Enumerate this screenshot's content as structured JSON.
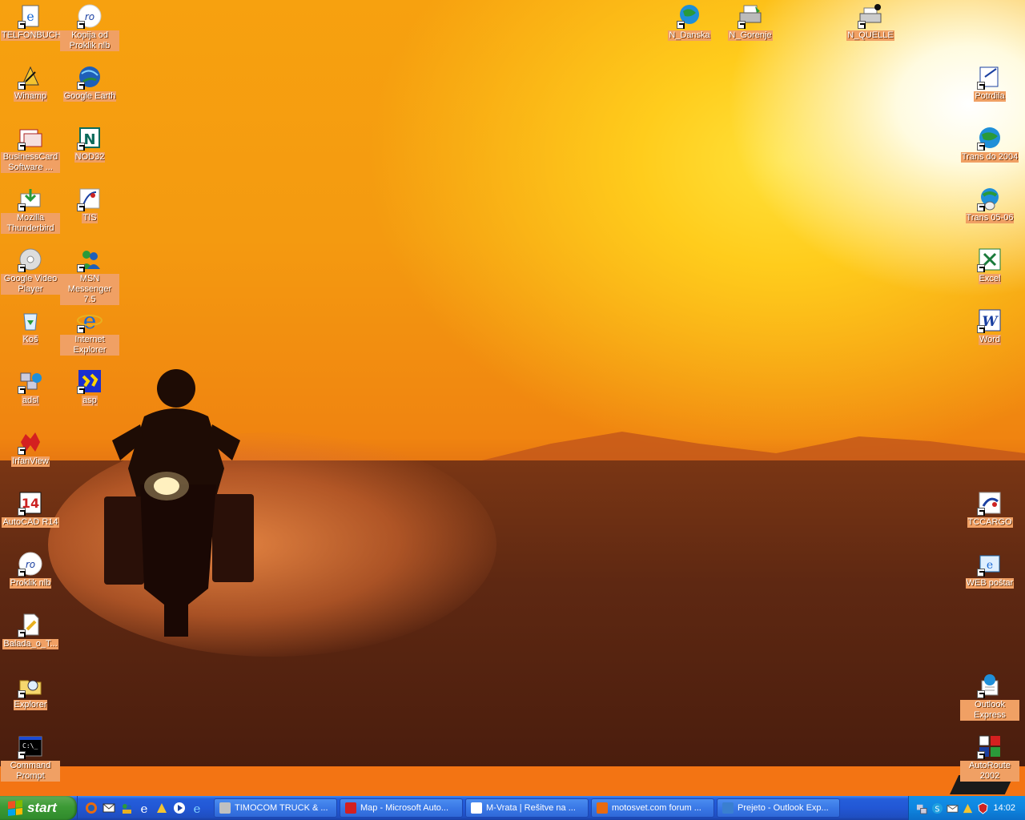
{
  "desktop": {
    "icons": [
      {
        "label": "TELFONBUCH",
        "icon": "internet-explorer-doc-icon"
      },
      {
        "label": "Kopija od Proklik nlb",
        "icon": "proklik-icon"
      },
      {
        "label": "Winamp",
        "icon": "winamp-icon"
      },
      {
        "label": "Google Earth",
        "icon": "google-earth-icon"
      },
      {
        "label": "BusinessCard Software ...",
        "icon": "businesscard-icon"
      },
      {
        "label": "NOD32",
        "icon": "nod32-icon"
      },
      {
        "label": "Mozilla Thunderbird",
        "icon": "thunderbird-icon"
      },
      {
        "label": "TIS",
        "icon": "tis-icon"
      },
      {
        "label": "Google Video Player",
        "icon": "google-video-icon"
      },
      {
        "label": "MSN Messenger 7.5",
        "icon": "msn-messenger-icon"
      },
      {
        "label": "Koš",
        "icon": "recycle-bin-icon"
      },
      {
        "label": "Internet Explorer",
        "icon": "internet-explorer-icon"
      },
      {
        "label": "adsl",
        "icon": "network-icon"
      },
      {
        "label": "asp",
        "icon": "asp-icon"
      },
      {
        "label": "IrfanView",
        "icon": "irfanview-icon"
      },
      {
        "label": "AutoCAD R14",
        "icon": "autocad-icon"
      },
      {
        "label": "Proklik nlb",
        "icon": "proklik-icon"
      },
      {
        "label": "Balada_o_T...",
        "icon": "document-icon"
      },
      {
        "label": "Explorer",
        "icon": "explorer-icon"
      },
      {
        "label": "Command Prompt",
        "icon": "command-prompt-icon"
      },
      {
        "label": "N_Danska",
        "icon": "network-globe-icon"
      },
      {
        "label": "N_Gorenje",
        "icon": "printer-icon"
      },
      {
        "label": "N_QUELLE",
        "icon": "printer-default-icon"
      },
      {
        "label": "Potrdila",
        "icon": "certificate-icon"
      },
      {
        "label": "Trans do 2004",
        "icon": "globe-icon"
      },
      {
        "label": "Trans 05-06",
        "icon": "globe-mouse-icon"
      },
      {
        "label": "Excel",
        "icon": "excel-icon"
      },
      {
        "label": "Word",
        "icon": "word-icon"
      },
      {
        "label": "TCCARGO",
        "icon": "tccargo-icon"
      },
      {
        "label": "WEB poštar",
        "icon": "web-postar-icon"
      },
      {
        "label": "Outlook Express",
        "icon": "outlook-express-icon"
      },
      {
        "label": "AutoRoute 2002",
        "icon": "autoroute-icon"
      }
    ]
  },
  "taskbar": {
    "start_label": "start",
    "quick_launch": [
      "firefox-icon",
      "outlook-icon",
      "msn-icon",
      "ie-icon",
      "winamp-icon",
      "media-player-icon",
      "ie-alt-icon"
    ],
    "tasks": [
      {
        "label": "TIMOCOM TRUCK & ...",
        "color": "#c0c0c0"
      },
      {
        "label": "Map - Microsoft Auto...",
        "color": "#d42020"
      },
      {
        "label": "M-Vrata | Rešitve na ...",
        "color": "#ffffff"
      },
      {
        "label": "motosvet.com forum ...",
        "color": "#e86a10"
      },
      {
        "label": "Prejeto - Outlook Exp...",
        "color": "#3a7fd0"
      }
    ],
    "tray_icons": [
      "network-icon",
      "skype-icon",
      "mail-icon",
      "winamp-icon",
      "antivirus-icon"
    ],
    "clock": "14:02"
  },
  "colors": {
    "taskbar_blue": "#245edb",
    "start_green": "#3c9a35",
    "wallpaper_orange": "#f49a10",
    "ktm_orange": "#f37413"
  }
}
